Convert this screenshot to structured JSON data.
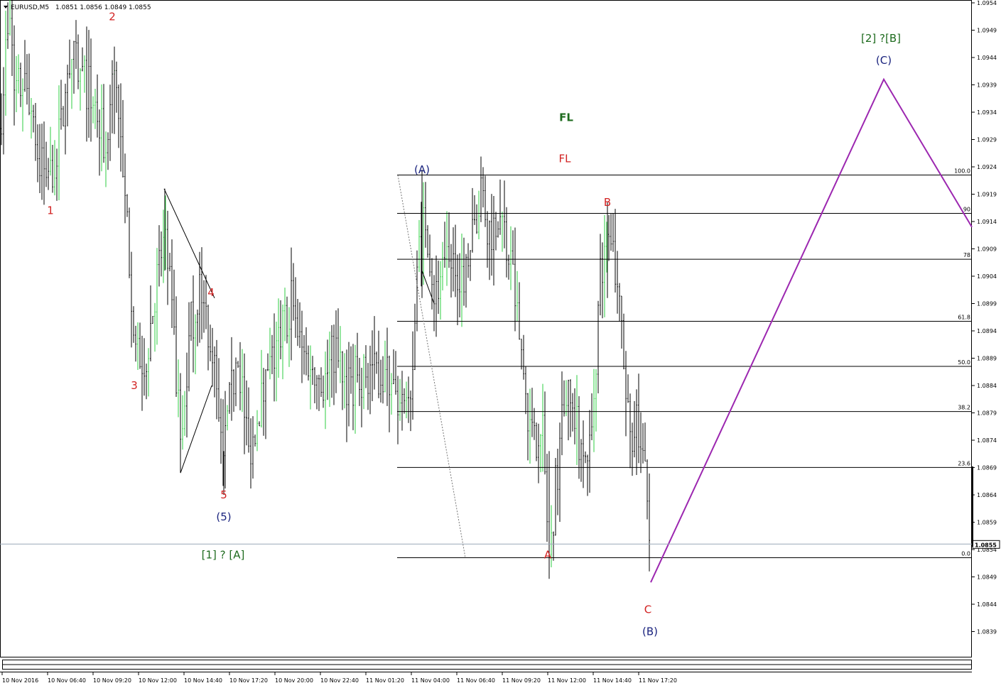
{
  "header": {
    "symbol": "EURUSD,M5",
    "ohlc": "1.0851 1.0856 1.0849 1.0855"
  },
  "colors": {
    "bar": "#000000",
    "bull": "#2ecc40",
    "wave_red": "#d22222",
    "wave_navy": "#1a237e",
    "wave_green": "#1e6b1e",
    "projection": "#9c27b0",
    "grid": "#000000"
  },
  "chart_data": {
    "type": "ohlc",
    "symbol": "EURUSD",
    "timeframe": "M5",
    "y_ticks": [
      1.0954,
      1.0949,
      1.0944,
      1.0939,
      1.0934,
      1.0929,
      1.0924,
      1.0919,
      1.0914,
      1.0909,
      1.0904,
      1.0899,
      1.0894,
      1.0889,
      1.0884,
      1.0879,
      1.0874,
      1.0869,
      1.0864,
      1.0859,
      1.0854,
      1.0849,
      1.0844,
      1.0839
    ],
    "ylim": [
      1.0835,
      1.0955
    ],
    "x_ticks": [
      "10 Nov 2016",
      "10 Nov 06:40",
      "10 Nov 09:20",
      "10 Nov 12:00",
      "10 Nov 14:40",
      "10 Nov 17:20",
      "10 Nov 20:00",
      "10 Nov 22:40",
      "11 Nov 01:20",
      "11 Nov 04:00",
      "11 Nov 06:40",
      "11 Nov 09:20",
      "11 Nov 12:00",
      "11 Nov 14:40",
      "11 Nov 17:20"
    ],
    "current_price": "1.0855",
    "price_path": [
      [
        0,
        1.0931
      ],
      [
        8,
        1.0945
      ],
      [
        15,
        1.095
      ],
      [
        22,
        1.0938
      ],
      [
        35,
        1.0939
      ],
      [
        45,
        1.0935
      ],
      [
        55,
        1.0925
      ],
      [
        70,
        1.0922
      ],
      [
        85,
        1.093
      ],
      [
        100,
        1.0944
      ],
      [
        118,
        1.094
      ],
      [
        135,
        1.0935
      ],
      [
        150,
        1.0926
      ],
      [
        162,
        1.0945
      ],
      [
        172,
        1.0922
      ],
      [
        182,
        1.0908
      ],
      [
        192,
        1.0888
      ],
      [
        205,
        1.0889
      ],
      [
        220,
        1.0903
      ],
      [
        232,
        1.0912
      ],
      [
        240,
        1.09
      ],
      [
        248,
        1.0885
      ],
      [
        255,
        1.0872
      ],
      [
        268,
        1.0895
      ],
      [
        282,
        1.0902
      ],
      [
        300,
        1.089
      ],
      [
        312,
        1.087
      ],
      [
        325,
        1.0882
      ],
      [
        335,
        1.089
      ],
      [
        350,
        1.0872
      ],
      [
        365,
        1.088
      ],
      [
        380,
        1.0887
      ],
      [
        395,
        1.0893
      ],
      [
        410,
        1.09
      ],
      [
        425,
        1.089
      ],
      [
        440,
        1.0888
      ],
      [
        455,
        1.0884
      ],
      [
        470,
        1.089
      ],
      [
        490,
        1.0884
      ],
      [
        510,
        1.0886
      ],
      [
        530,
        1.0887
      ],
      [
        550,
        1.0885
      ],
      [
        568,
        1.0877
      ],
      [
        580,
        1.0886
      ],
      [
        590,
        1.091
      ],
      [
        600,
        1.0915
      ],
      [
        612,
        1.09
      ],
      [
        625,
        1.0905
      ],
      [
        640,
        1.0906
      ],
      [
        655,
        1.0905
      ],
      [
        670,
        1.0915
      ],
      [
        678,
        1.0919
      ],
      [
        690,
        1.0912
      ],
      [
        705,
        1.0915
      ],
      [
        718,
        1.0907
      ],
      [
        730,
        1.0895
      ],
      [
        742,
        1.088
      ],
      [
        752,
        1.0873
      ],
      [
        762,
        1.088
      ],
      [
        773,
        1.0853
      ],
      [
        782,
        1.0865
      ],
      [
        795,
        1.0883
      ],
      [
        808,
        1.0878
      ],
      [
        820,
        1.0872
      ],
      [
        832,
        1.0873
      ],
      [
        845,
        1.0905
      ],
      [
        855,
        1.091
      ],
      [
        868,
        1.0905
      ],
      [
        878,
        1.0888
      ],
      [
        888,
        1.0875
      ],
      [
        898,
        1.0878
      ],
      [
        907,
        1.0868
      ],
      [
        913,
        1.086
      ],
      [
        916,
        1.0851
      ]
    ],
    "fibonacci": {
      "high": 1.09225,
      "low": 1.08525,
      "levels": [
        {
          "ratio": 1.0,
          "label": "100.0"
        },
        {
          "ratio": 0.9,
          "label": "90"
        },
        {
          "ratio": 0.78,
          "label": "78"
        },
        {
          "ratio": 0.618,
          "label": "61.8"
        },
        {
          "ratio": 0.5,
          "label": "50.0"
        },
        {
          "ratio": 0.382,
          "label": "38.2"
        },
        {
          "ratio": 0.236,
          "label": "23.6"
        },
        {
          "ratio": 0.0,
          "label": "0.0"
        }
      ]
    },
    "projection": [
      {
        "time": "11 Nov 17:20",
        "price": 1.0848
      },
      {
        "label": "(C)",
        "price": 1.094
      },
      {
        "price": 1.0913
      }
    ],
    "wave_labels": [
      {
        "text": "1",
        "color": "red",
        "price": 1.0916
      },
      {
        "text": "2",
        "color": "red",
        "price": 1.09515
      },
      {
        "text": "3",
        "color": "red",
        "price": 1.0884
      },
      {
        "text": "4",
        "color": "red",
        "price": 1.0901
      },
      {
        "text": "5",
        "color": "red",
        "price": 1.0864
      },
      {
        "text": "(5)",
        "color": "navy",
        "price": 1.086
      },
      {
        "text": "[1] ? [A]",
        "color": "green",
        "price": 1.0853
      },
      {
        "text": "(A)",
        "color": "navy",
        "price": 1.09235
      },
      {
        "text": "FL",
        "color": "green",
        "price": 1.0933
      },
      {
        "text": "FL",
        "color": "red",
        "price": 1.09255
      },
      {
        "text": "B",
        "color": "red",
        "price": 1.09175
      },
      {
        "text": "A",
        "color": "red",
        "price": 1.0853
      },
      {
        "text": "C",
        "color": "red",
        "price": 1.0843
      },
      {
        "text": "(B)",
        "color": "navy",
        "price": 1.0839
      },
      {
        "text": "[2] ?[B]",
        "color": "green",
        "price": 1.09475
      },
      {
        "text": "(C)",
        "color": "navy",
        "price": 1.09435
      }
    ]
  }
}
